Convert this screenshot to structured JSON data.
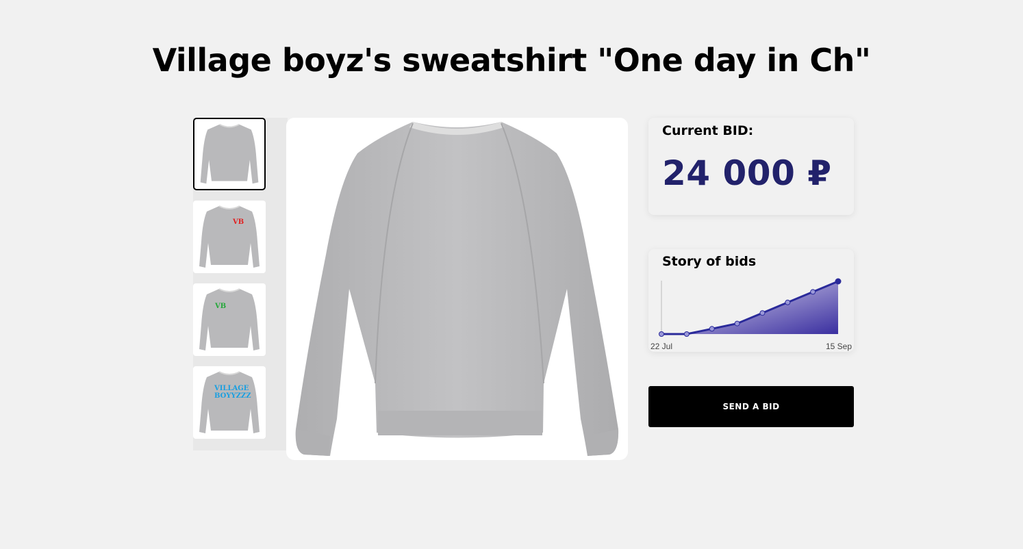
{
  "product": {
    "title": "Village boyz's sweatshirt \"One day in Ch\""
  },
  "gallery": {
    "thumbnails": [
      {
        "label": "",
        "color": "#000000",
        "active": true
      },
      {
        "label": "VB",
        "color": "#e02020",
        "active": false
      },
      {
        "label": "VB",
        "color": "#25a83a",
        "active": false
      },
      {
        "label": "VILLAGE BOYYZZZ",
        "color": "#1a9fe0",
        "active": false
      }
    ]
  },
  "bid": {
    "label": "Current BID:",
    "value": "24 000 ₽",
    "accent_color": "#22226b"
  },
  "history": {
    "label": "Story of bids"
  },
  "chart_data": {
    "type": "area",
    "title": "Story of bids",
    "x_tick_labels": [
      "22 Jul",
      "15 Sep"
    ],
    "values": [
      0,
      0,
      0.1,
      0.2,
      0.4,
      0.6,
      0.8,
      1.0
    ],
    "color": "#2a2a9a"
  },
  "actions": {
    "send_bid_label": "SEND A BID"
  }
}
